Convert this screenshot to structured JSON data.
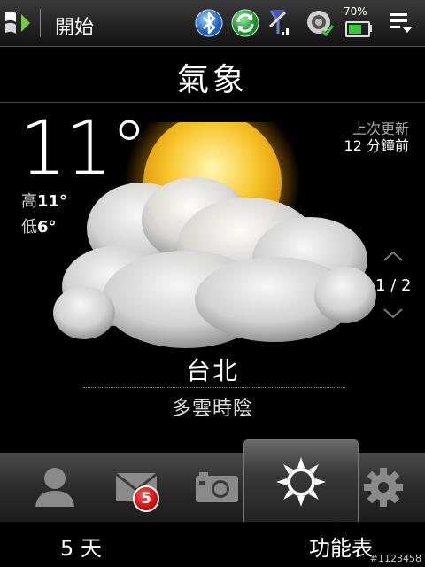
{
  "status_bar": {
    "start_label": "開始",
    "battery_percent": "70%",
    "battery_level": 0.7,
    "icons": [
      "windows-flag-icon",
      "bluetooth-icon",
      "sync-icon",
      "signal-antenna-icon",
      "volume-icon",
      "battery-icon",
      "menu-icon"
    ]
  },
  "weather": {
    "title": "氣象",
    "temperature": "11°",
    "high_label": "高",
    "high_value": "11°",
    "low_label": "低",
    "low_value": "6°",
    "updated_line1": "上次更新",
    "updated_line2": "12 分鐘前",
    "page_indicator": "1 / 2",
    "city": "台北",
    "condition": "多雲時陰"
  },
  "tabs": {
    "items": [
      "contact-tab",
      "mail-tab",
      "camera-tab",
      "weather-tab",
      "settings-tab"
    ],
    "mail_badge": "5",
    "active": "weather-tab"
  },
  "softkeys": {
    "left": "5 天",
    "right": "功能表"
  },
  "watermark": "#1123458"
}
